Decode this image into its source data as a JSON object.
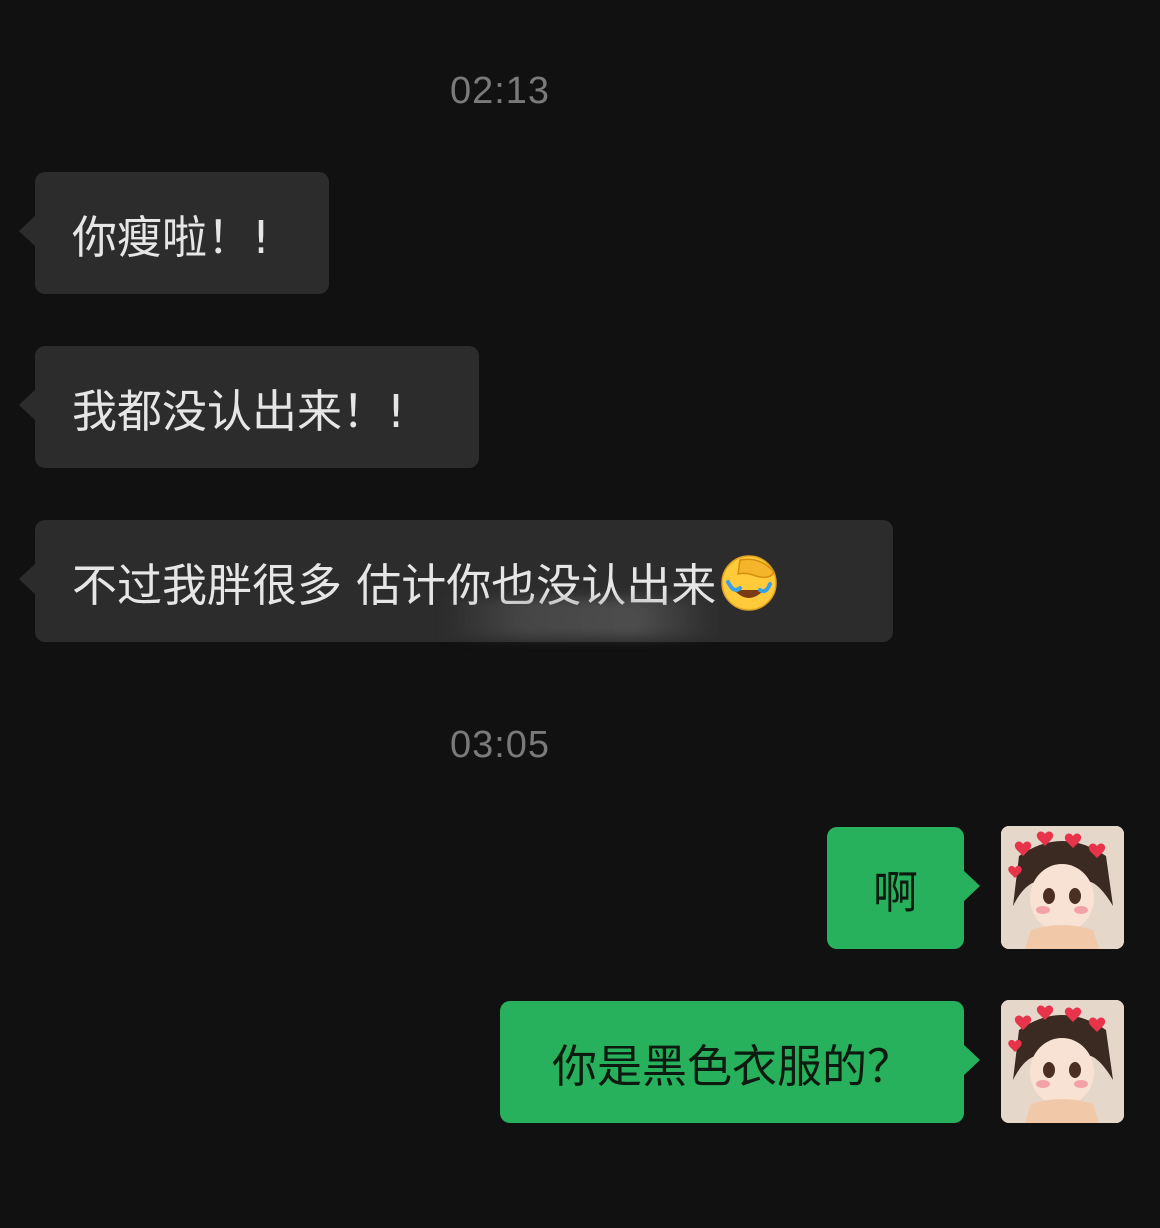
{
  "timestamps": [
    "02:13",
    "03:05"
  ],
  "messages": [
    {
      "direction": "incoming",
      "text": "你瘦啦！!"
    },
    {
      "direction": "incoming",
      "text": "我都没认出来！!"
    },
    {
      "direction": "incoming",
      "text": "不过我胖很多 估计你也没认出来",
      "emoji": "facepalm-laughing-emoji"
    },
    {
      "direction": "outgoing",
      "text": "啊"
    },
    {
      "direction": "outgoing",
      "text": "你是黑色衣服的？"
    }
  ],
  "colors": {
    "background": "#111111",
    "incoming_bubble": "#2c2c2c",
    "outgoing_bubble": "#28b15c",
    "timestamp_text": "#7a7a7a"
  }
}
